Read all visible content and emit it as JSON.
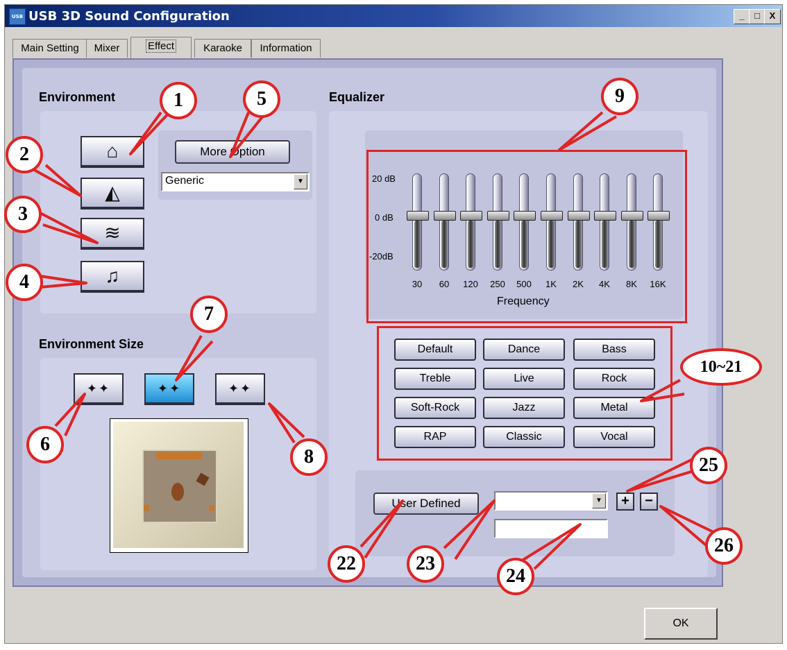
{
  "window": {
    "app_icon": "USB",
    "title": "USB 3D Sound Configuration",
    "minimize": "_",
    "maximize": "□",
    "close": "X"
  },
  "tabs": [
    {
      "label": "Main Setting"
    },
    {
      "label": "Mixer"
    },
    {
      "label": "Effect"
    },
    {
      "label": "Karaoke"
    },
    {
      "label": "Information"
    }
  ],
  "environment": {
    "title": "Environment",
    "more_option_label": "More Option",
    "preset_select_value": "Generic",
    "buttons": [
      {
        "icon": "house-icon"
      },
      {
        "icon": "opera-house-icon"
      },
      {
        "icon": "underwater-icon"
      },
      {
        "icon": "concert-performer-icon"
      }
    ]
  },
  "environment_size": {
    "title": "Environment Size",
    "buttons": [
      {
        "icon": "small-room-icon",
        "active": false
      },
      {
        "icon": "medium-room-icon",
        "active": true
      },
      {
        "icon": "large-room-icon",
        "active": false
      }
    ]
  },
  "equalizer": {
    "title": "Equalizer",
    "db_labels": [
      "20 dB",
      "0  dB",
      "-20dB"
    ],
    "bands": [
      "30",
      "60",
      "120",
      "250",
      "500",
      "1K",
      "2K",
      "4K",
      "8K",
      "16K"
    ],
    "band_gain_db": [
      0,
      0,
      0,
      0,
      0,
      0,
      0,
      0,
      0,
      0
    ],
    "axis_label": "Frequency",
    "presets": [
      "Default",
      "Dance",
      "Bass",
      "Treble",
      "Live",
      "Rock",
      "Soft-Rock",
      "Jazz",
      "Metal",
      "RAP",
      "Classic",
      "Vocal"
    ],
    "user_defined_label": "User  Defined",
    "user_select_value": "",
    "user_name_value": "",
    "add_label": "+",
    "remove_label": "−"
  },
  "callouts": [
    "1",
    "2",
    "3",
    "4",
    "5",
    "6",
    "7",
    "8",
    "9",
    "10~21",
    "22",
    "23",
    "24",
    "25",
    "26"
  ],
  "footer": {
    "ok_label": "OK"
  },
  "colors": {
    "callout": "#e02424",
    "panel": "#aeb1d2",
    "title_bar": "#08246b"
  }
}
